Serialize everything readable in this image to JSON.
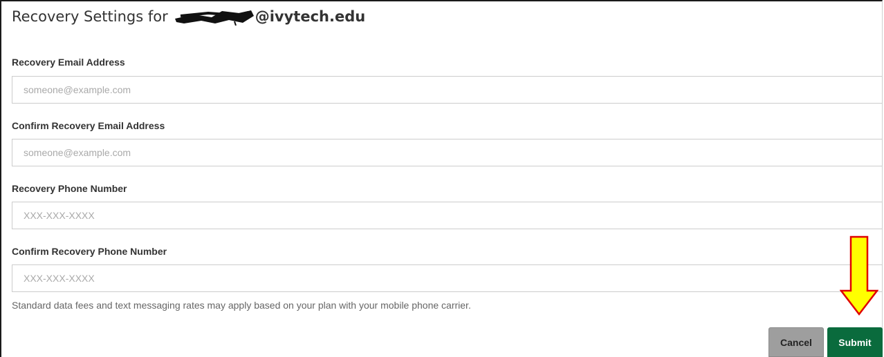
{
  "header": {
    "title_prefix": "Recovery Settings for",
    "title_domain": "@ivytech.edu"
  },
  "form": {
    "recovery_email": {
      "label": "Recovery Email Address",
      "placeholder": "someone@example.com",
      "value": ""
    },
    "confirm_recovery_email": {
      "label": "Confirm Recovery Email Address",
      "placeholder": "someone@example.com",
      "value": ""
    },
    "recovery_phone": {
      "label": "Recovery Phone Number",
      "placeholder": "XXX-XXX-XXXX",
      "value": ""
    },
    "confirm_recovery_phone": {
      "label": "Confirm Recovery Phone Number",
      "placeholder": "XXX-XXX-XXXX",
      "value": ""
    },
    "note": "Standard data fees and text messaging rates may apply based on your plan with your mobile phone carrier."
  },
  "actions": {
    "cancel_label": "Cancel",
    "submit_label": "Submit"
  },
  "annotation": {
    "icon": "down-arrow-icon",
    "fill_color": "#ffff00",
    "stroke_color": "#e00000"
  },
  "colors": {
    "submit_bg": "#0a6b3d",
    "cancel_bg": "#9e9e9e"
  }
}
